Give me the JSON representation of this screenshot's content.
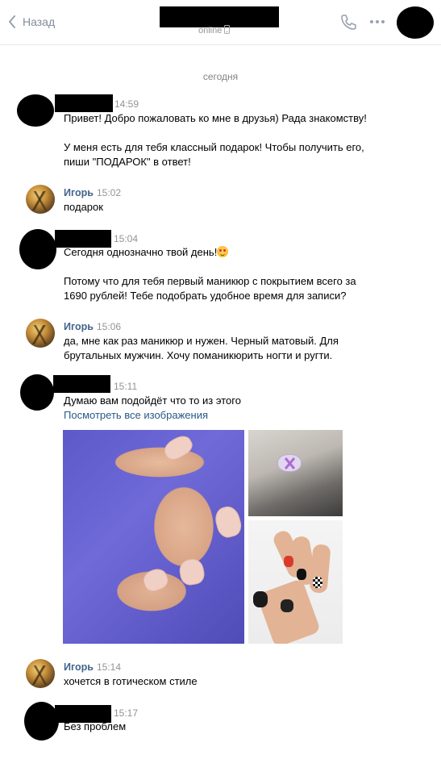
{
  "header": {
    "back_label": "Назад",
    "status": "online",
    "icons": {
      "back": "chevron-left-icon",
      "phone": "phone-icon",
      "more": "more-dots-icon",
      "mobile": "mobile-icon"
    }
  },
  "date_separator": "сегодня",
  "messages": [
    {
      "author": "",
      "time": "14:59",
      "text": "Привет! Добро пожаловать ко мне в друзья) Рада знакомству!\n\nУ меня есть для тебя классный подарок! Чтобы получить его,\nпиши \"ПОДАРОК\" в ответ!"
    },
    {
      "author": "Игорь",
      "time": "15:02",
      "text": "подарок"
    },
    {
      "author": "",
      "time": "15:04",
      "text_line1": "Сегодня однозначно твой день!",
      "emoji": "star-struck-emoji",
      "text_rest": "Потому что для тебя первый маникюр с покрытием всего за\n1690 рублей! Тебе подобрать удобное время для записи?"
    },
    {
      "author": "Игорь",
      "time": "15:06",
      "text": "да, мне как раз маникюр и нужен. Черный матовый. Для\nбрутальных мужчин. Хочу поманикюрить ногти и ругти."
    },
    {
      "author": "",
      "time": "15:11",
      "text": "Думаю вам подойдёт что то из этого",
      "link": "Посмотреть все изображения"
    },
    {
      "author": "Игорь",
      "time": "15:14",
      "text": "хочется в готическом стиле"
    },
    {
      "author": "",
      "time": "15:17",
      "text": "Без проблем"
    }
  ]
}
